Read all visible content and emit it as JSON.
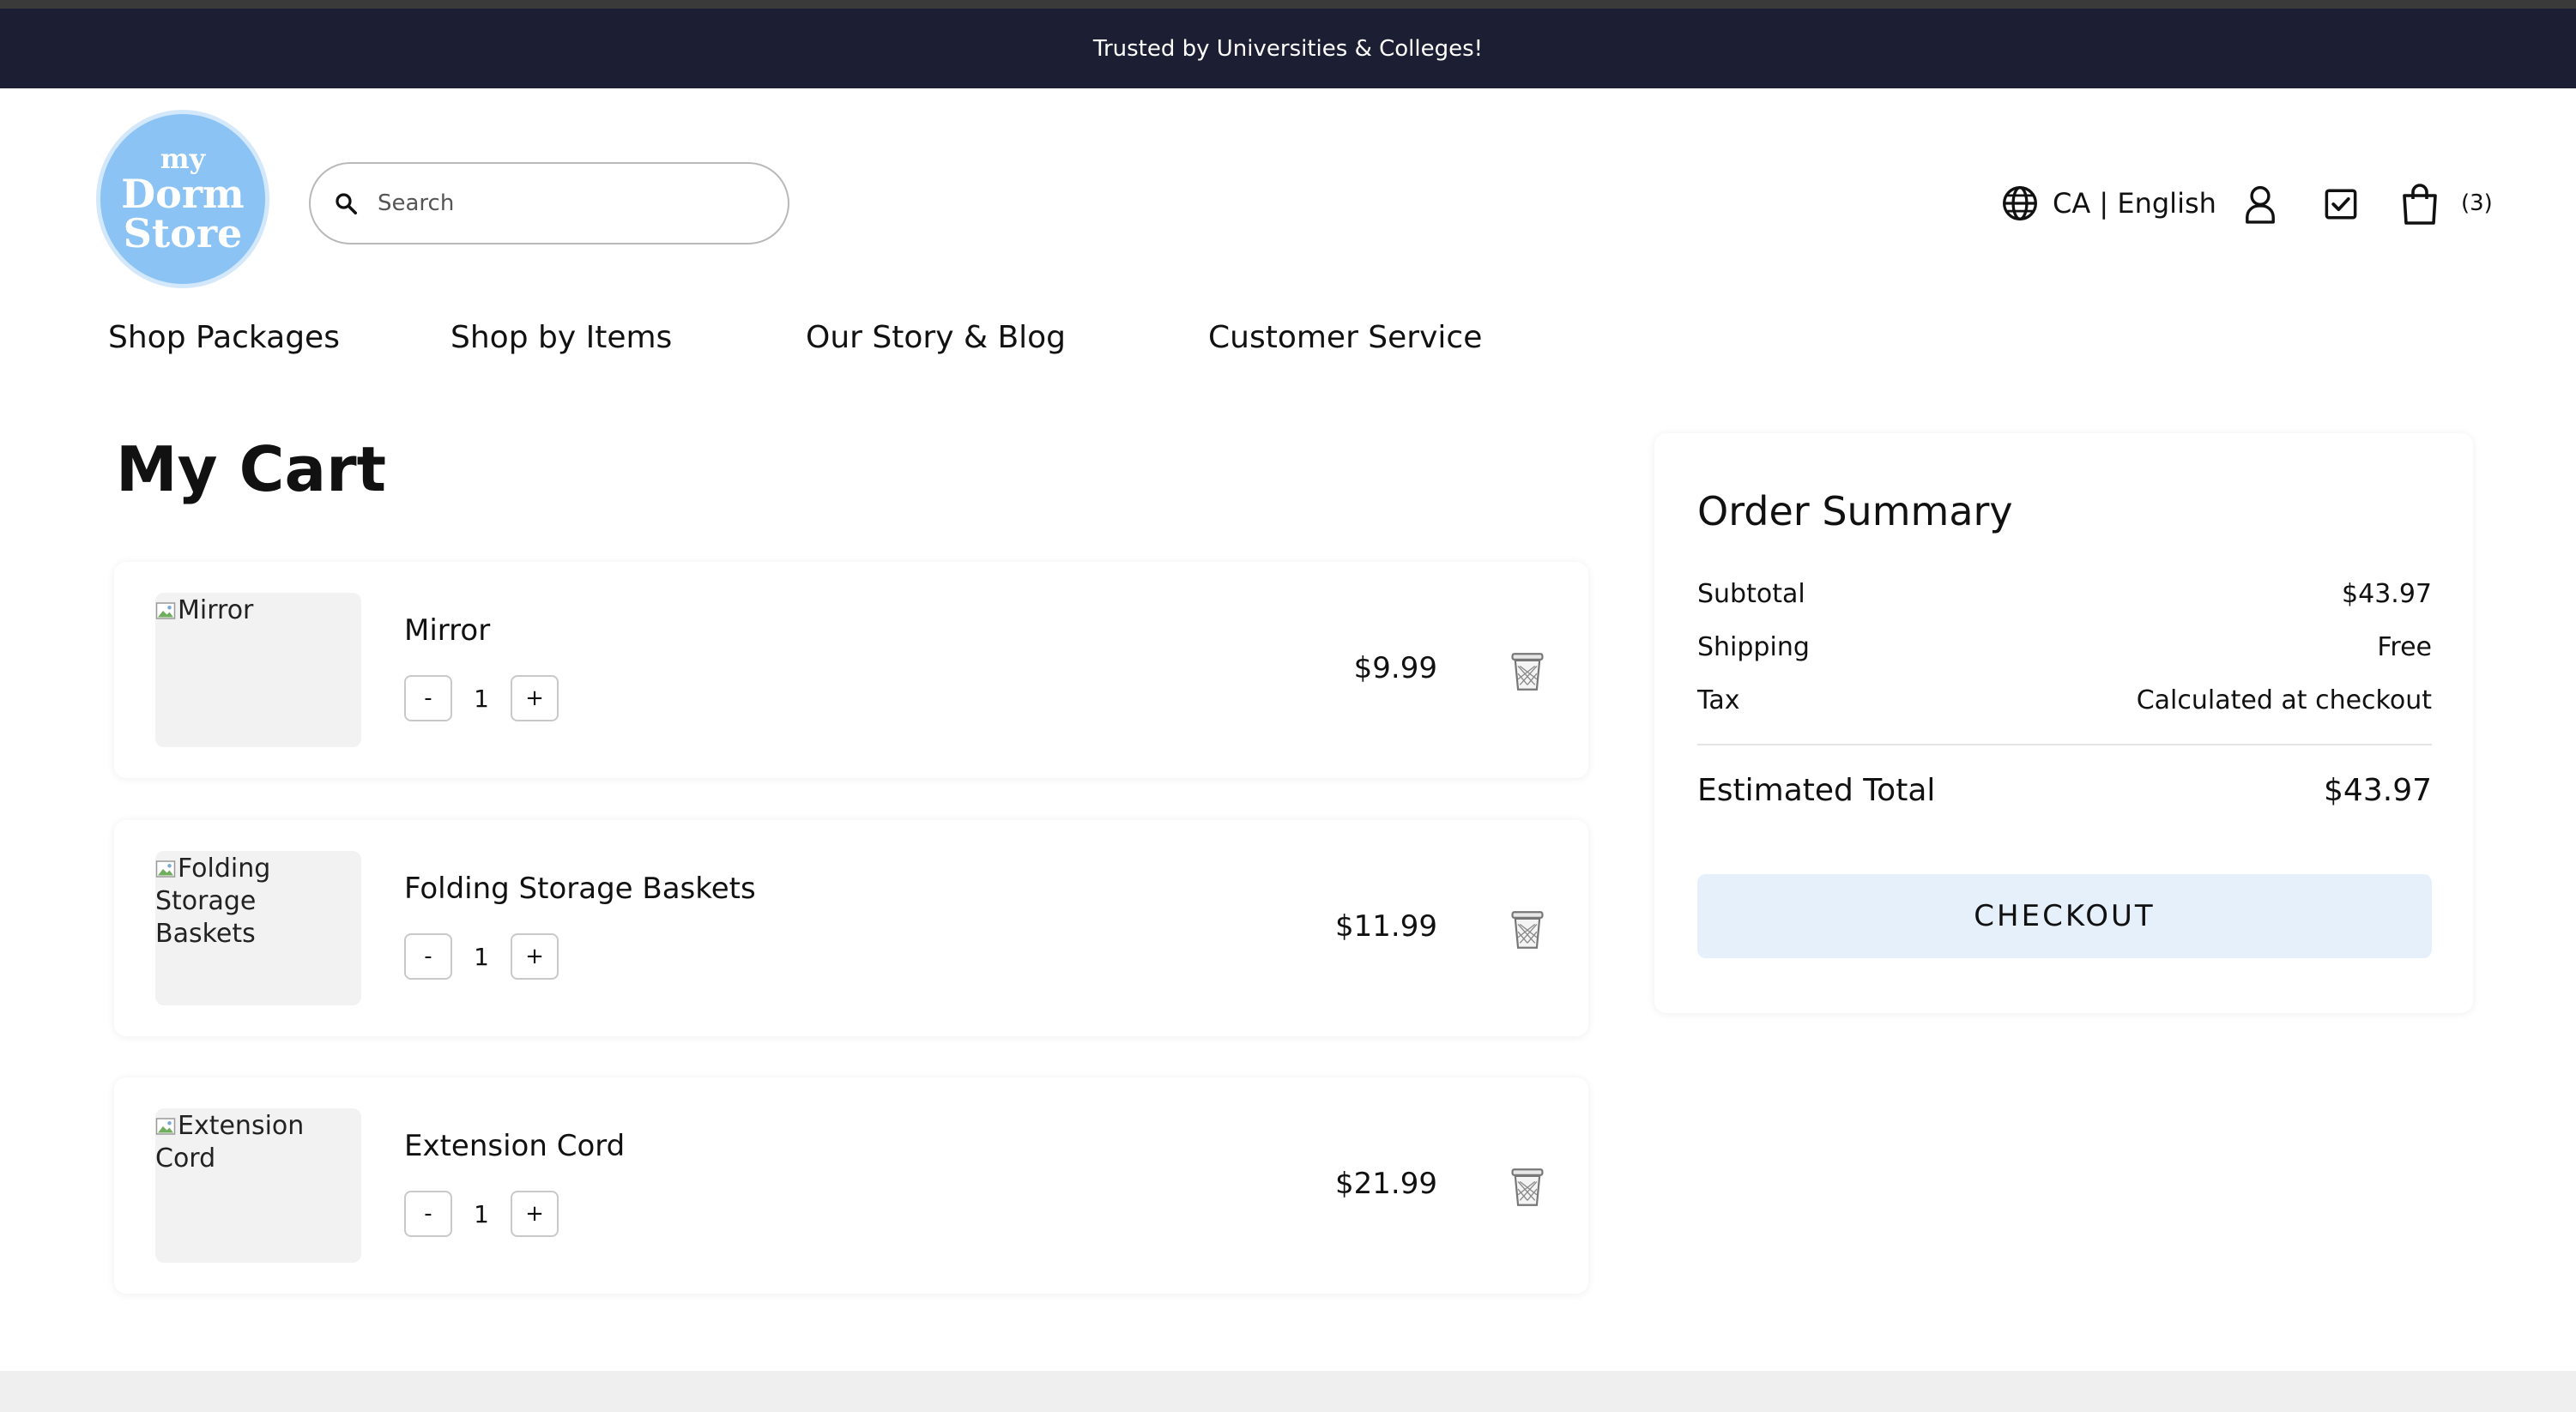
{
  "announcement": "Trusted by Universities & Colleges!",
  "logo": {
    "line1": "my",
    "line2": "Dorm",
    "line3": "Store"
  },
  "search": {
    "placeholder": "Search"
  },
  "header": {
    "locale": "CA | English",
    "cart_count": "(3)"
  },
  "nav": {
    "items": [
      "Shop Packages",
      "Shop by Items",
      "Our Story & Blog",
      "Customer Service"
    ]
  },
  "cart": {
    "title": "My Cart",
    "items": [
      {
        "name": "Mirror",
        "image_alt": "Mirror",
        "qty": "1",
        "price": "$9.99",
        "minus": "-",
        "plus": "+"
      },
      {
        "name": "Folding Storage Baskets",
        "image_alt": "Folding Storage Baskets",
        "qty": "1",
        "price": "$11.99",
        "minus": "-",
        "plus": "+"
      },
      {
        "name": "Extension Cord",
        "image_alt": "Extension Cord",
        "qty": "1",
        "price": "$21.99",
        "minus": "-",
        "plus": "+"
      }
    ]
  },
  "summary": {
    "title": "Order Summary",
    "subtotal_label": "Subtotal",
    "subtotal_value": "$43.97",
    "shipping_label": "Shipping",
    "shipping_value": "Free",
    "tax_label": "Tax",
    "tax_value": "Calculated at checkout",
    "total_label": "Estimated Total",
    "total_value": "$43.97",
    "checkout_label": "CHECKOUT"
  },
  "icons": {
    "search": "search-icon",
    "globe": "globe-icon",
    "account": "user-icon",
    "checklist": "checklist-icon",
    "bag": "shopping-bag-icon",
    "trash": "trash-icon"
  },
  "colors": {
    "announcement_bg": "#1c1f33",
    "logo_bg": "#8cc3f5",
    "checkout_bg": "#e5f0fa"
  }
}
